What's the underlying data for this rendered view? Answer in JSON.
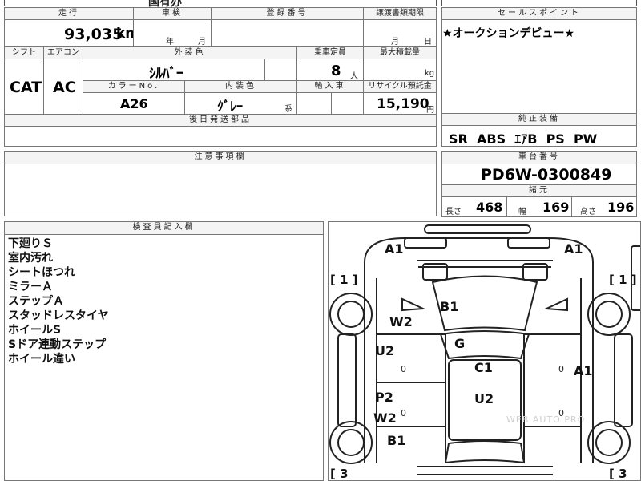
{
  "top_fragment": "国有办",
  "labels": {
    "mileage": "走行",
    "inspection": "車検",
    "reg_number": "登録番号",
    "transfer_doc": "譲渡書類期限",
    "sales_point": "セールスポイント",
    "shift": "シフト",
    "aircon": "エアコン",
    "exterior_color": "外装色",
    "capacity": "乗車定員",
    "max_load": "最大積載量",
    "color_no": "カラーNo.",
    "interior_color": "内装色",
    "import": "輸入車",
    "recycle": "リサイクル預託金",
    "later_parts": "後日発送部品",
    "genuine_equip": "純正装備",
    "caution": "注意事項欄",
    "chassis_no": "車台番号",
    "specs": "諸元",
    "inspector": "検査員記入欄"
  },
  "units": {
    "year": "年",
    "month": "月",
    "day": "日",
    "km": "km",
    "persons": "人",
    "kg": "kg",
    "yen": "円",
    "kei": "系"
  },
  "values": {
    "mileage": "93,035",
    "shift": "CAT",
    "aircon": "AC",
    "exterior_color": "ｼﾙﾊﾞｰ",
    "capacity": "8",
    "color_no": "A26",
    "interior_color": "ｸﾞﾚｰ",
    "recycle": "15,190",
    "sales_point": "★オークションデビュー★",
    "equipment": "SR  ABS  ｴｱB  PS  PW",
    "chassis_no": "PD6W-0300849"
  },
  "specs": {
    "length_label": "長さ",
    "length": "468",
    "width_label": "幅",
    "width": "169",
    "height_label": "高さ",
    "height": "196"
  },
  "inspector_notes": [
    "下廻りＳ",
    "室内汚れ",
    "シートほつれ",
    "ミラーＡ",
    "ステップＡ",
    "スタッドレスタイヤ",
    "ホイールS",
    "Sドア連動ステップ",
    "ホイール違い"
  ],
  "diagram": {
    "left_front_num": "[ 1 ]",
    "right_front_num": "[ 1 ]",
    "left_rear_num": "[ 3",
    "right_rear_num": "[ 3",
    "marks": {
      "front_left": "A1",
      "front_right": "A1",
      "hood": "B1",
      "left_fender": "W2",
      "left_front_door": "U2",
      "windshield": "G",
      "roof": "C1",
      "right_door": "A1",
      "roof_rear": "U2",
      "left_rear_door_p": "P2",
      "left_rear_door_w": "W2",
      "left_rear_fender": "B1",
      "door_zero_left_1": "0",
      "door_zero_left_2": "0",
      "door_zero_right_1": "0",
      "door_zero_right_2": "0"
    },
    "watermark": "WEB AUTO PRO"
  }
}
